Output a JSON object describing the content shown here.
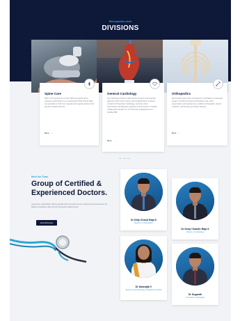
{
  "divisions": {
    "eyebrow": "Best practice used",
    "title": "DIVISIONS",
    "cards": [
      {
        "title": "Spine Care",
        "desc": "With a rich experience of over 3000 successful spine surgeries performed by our renowned Dr Dilip Chand Raja, we specialise in both non surgical and surgical treatment for all spine related ailments.",
        "more": "More",
        "icon": "spine-icon"
      },
      {
        "title": "General Cardiology",
        "desc": "Our Cardiology division offers all the services and referrals right from ECG, Echo scans, and Treadmill tests to Expert consult for Preventive Cardiology, Coronary Stent Interventions and Bypass surgeries and services for Cardiac Imaging like Cardiac CT, CT Coronary Angiograms and Cardiac MRI.",
        "more": "More",
        "icon": "heart-icon"
      },
      {
        "title": "Orthopedics",
        "desc": "We provide state of the art treatment in all fields of orthopedic surgery including Trauma and Accident care, Joint preservation and replacement, pediatric orthopedics, Sports medicine, arthroscopy and Spine Surgery.",
        "more": "More",
        "icon": "bone-icon"
      }
    ]
  },
  "team": {
    "eyebrow": "Meet Our Team",
    "title": "Group of Certified & Experienced Doctors.",
    "desc": "Quis ipsum suspendisse ultrices gravida risus commodo viverra maecenas accumsan lacus vel facilisis consectetur adip elit sed consectetur adipiscing elit.",
    "button": "View All Doctors",
    "doctors": [
      {
        "name": "Dr Dilip Chand Raja S",
        "role": "Director of Orthopedics",
        "tie": "#4a78c0"
      },
      {
        "name": "Dr Deep Chandh Raja S",
        "role": "Director of Cardiology",
        "tie": "#2d2f3a"
      },
      {
        "name": "Dr Abarajda V",
        "role": "Director of Gynaecology, Obstetrics & Fertility",
        "tie": "#e59b2c"
      },
      {
        "name": "Dr Suganth",
        "role": "Consultant Cardiologist",
        "tie": "#7a2f36"
      }
    ]
  },
  "colors": {
    "navy": "#0d1838",
    "accent": "#27a9e1",
    "background": "#f2f3f6"
  }
}
